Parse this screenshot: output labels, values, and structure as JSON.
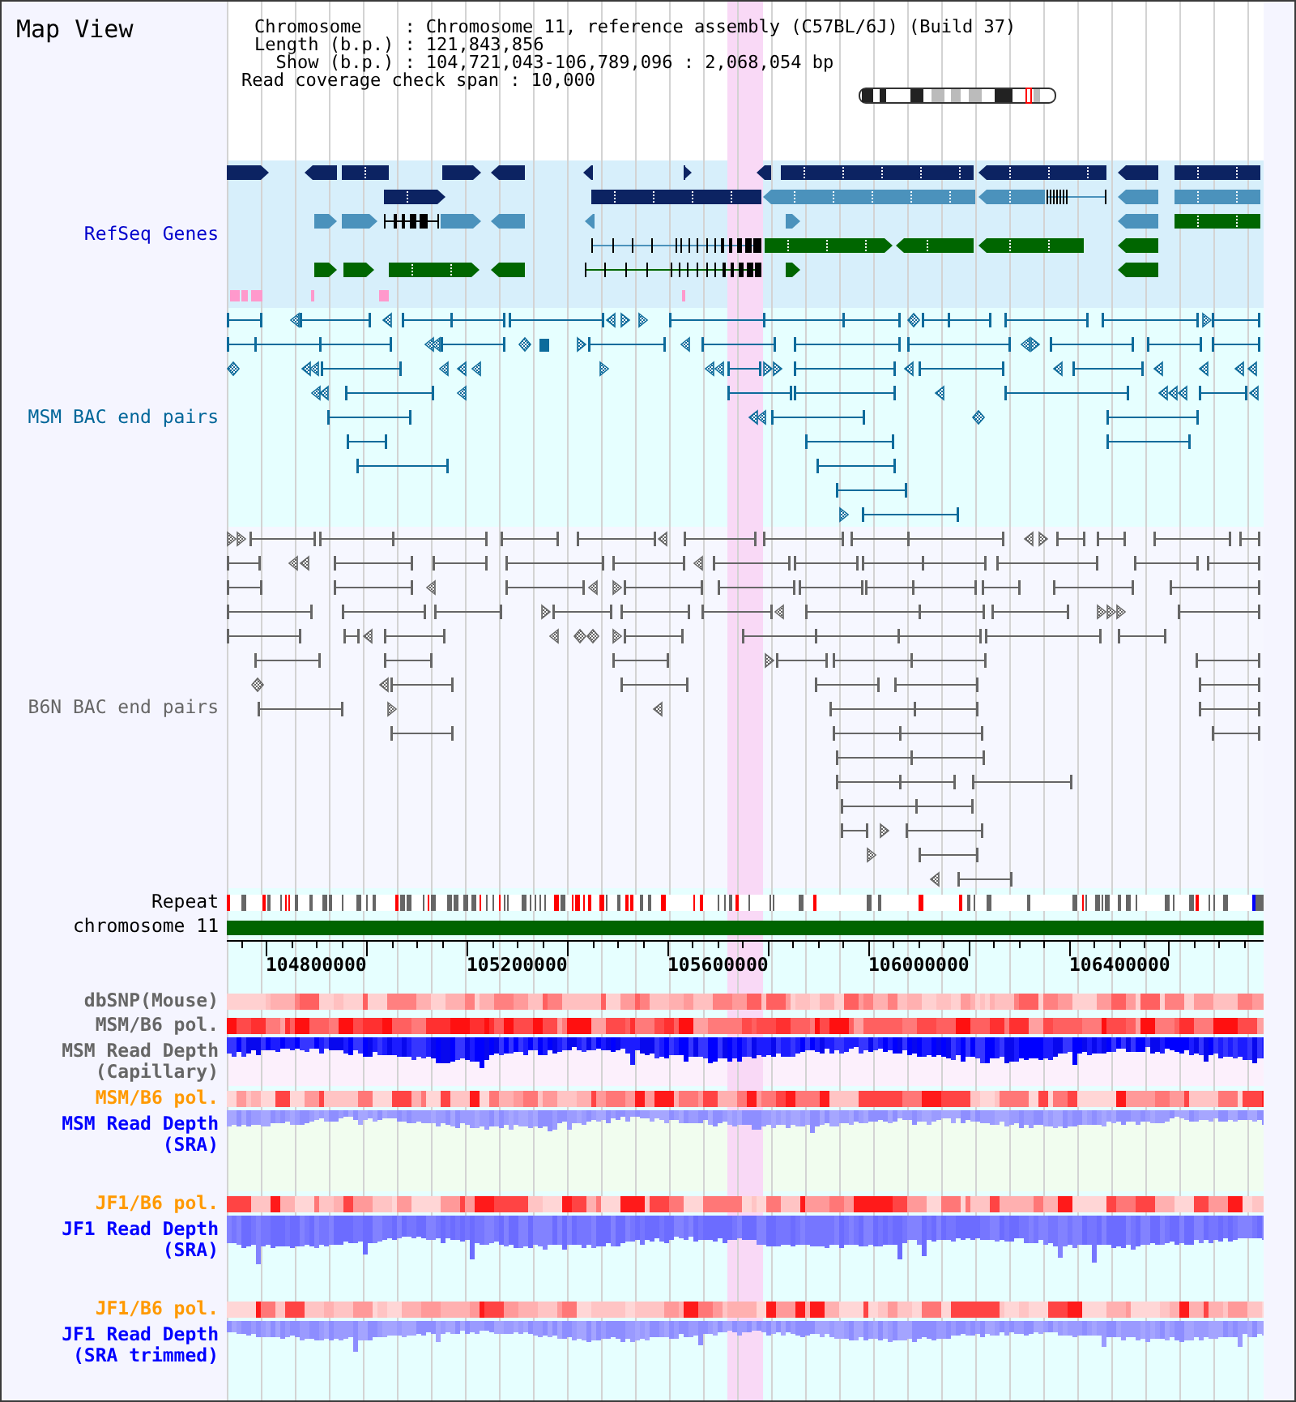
{
  "title": "Map View",
  "info": [
    {
      "label": "Chromosome",
      "value": ": Chromosome 11, reference assembly (C57BL/6J) (Build 37)"
    },
    {
      "label": "Length (b.p.)",
      "value": ": 121,843,856"
    },
    {
      "label": "Show (b.p.)",
      "value": ": 104,721,043-106,789,096 : 2,068,054 bp"
    }
  ],
  "span": {
    "label": "Read coverage check span",
    "value": ": 10,000"
  },
  "tracks": [
    {
      "kind": "genes",
      "label": "RefSeq Genes",
      "color": "#0000cc"
    },
    {
      "kind": "bac",
      "label": "MSM BAC end pairs",
      "color": "#006699"
    },
    {
      "kind": "bac",
      "label": "B6N BAC end pairs",
      "color": "#666666"
    },
    {
      "kind": "repeat",
      "label": "Repeat",
      "color": "#000000"
    },
    {
      "kind": "chromosome",
      "label": "chromosome 11",
      "color": "#000000"
    },
    {
      "kind": "axis",
      "ticks": [
        "104800000",
        "105200000",
        "105600000",
        "106000000",
        "106400000"
      ]
    },
    {
      "kind": "snp",
      "label": "dbSNP(Mouse)",
      "color": "#666666"
    },
    {
      "kind": "pol",
      "label": "MSM/B6 pol.",
      "color": "#666666"
    },
    {
      "kind": "depth",
      "label": "MSM Read Depth (Capillary)",
      "color": "#666666"
    },
    {
      "kind": "pol",
      "label": "MSM/B6 pol.",
      "color": "#ff9900"
    },
    {
      "kind": "depth",
      "label": "MSM Read Depth (SRA)",
      "color": "#0000ff"
    },
    {
      "kind": "pol",
      "label": "JF1/B6 pol.",
      "color": "#ff9900"
    },
    {
      "kind": "depth",
      "label": "JF1 Read Depth (SRA)",
      "color": "#0000ff"
    },
    {
      "kind": "pol",
      "label": "JF1/B6 pol.",
      "color": "#ff9900"
    },
    {
      "kind": "depth",
      "label": "JF1 Read Depth (SRA trimmed)",
      "color": "#0000ff"
    }
  ]
}
